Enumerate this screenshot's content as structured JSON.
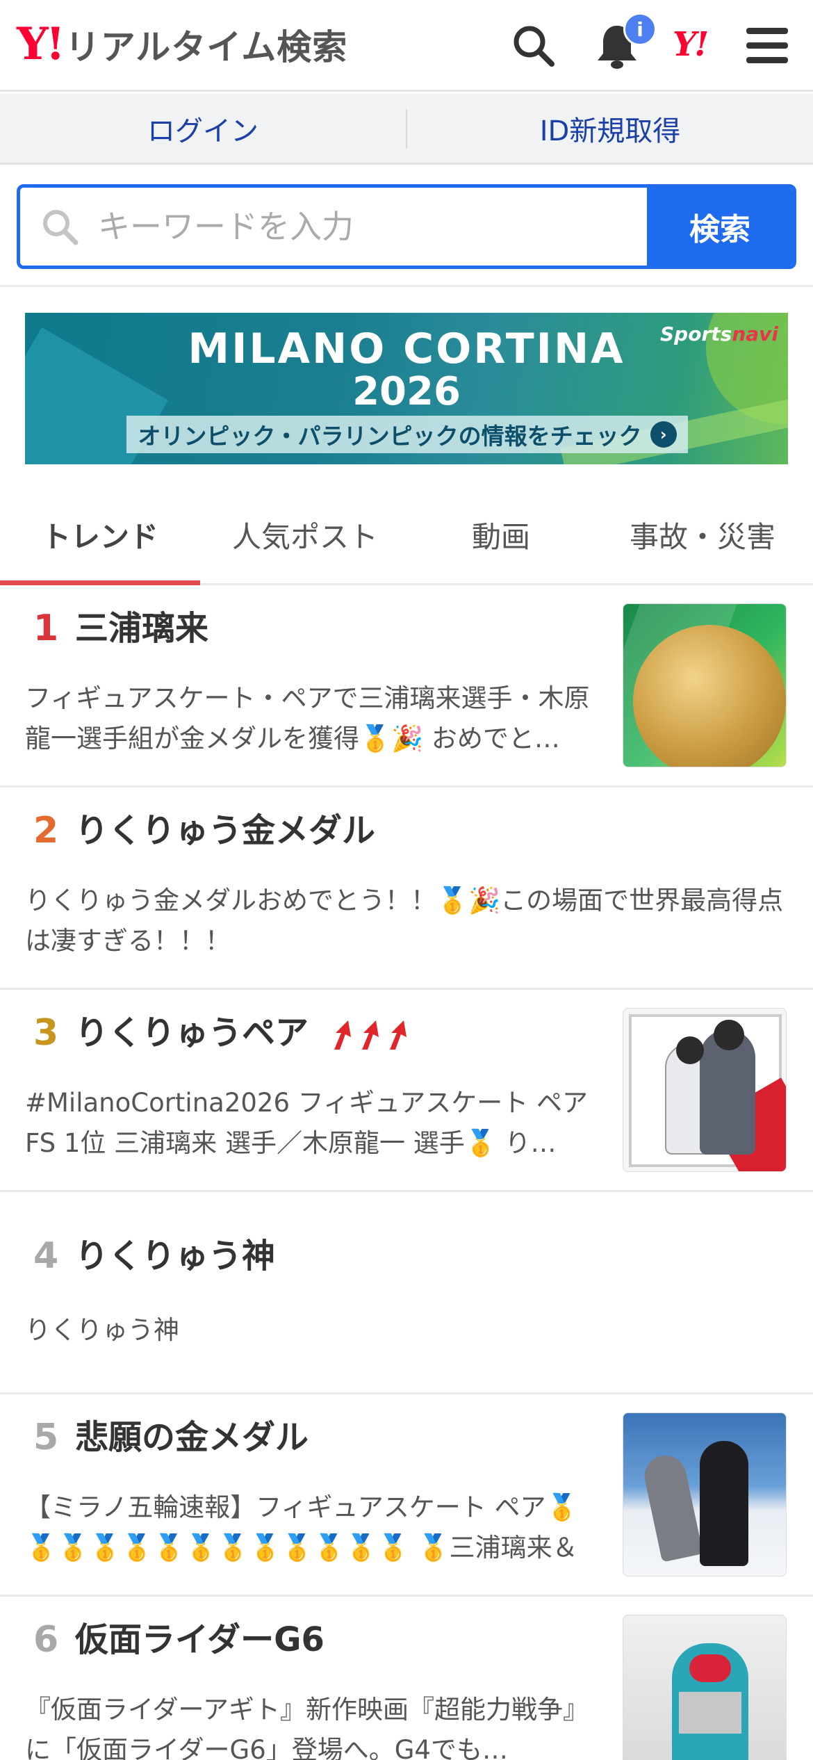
{
  "header": {
    "logo_mark": "Y!",
    "logo_text": "リアルタイム検索",
    "notification_badge": "i",
    "yj_mark": "Y!"
  },
  "account": {
    "login": "ログイン",
    "register": "ID新規取得"
  },
  "search": {
    "placeholder": "キーワードを入力",
    "button": "検索"
  },
  "banner": {
    "title": "MILANO CORTINA",
    "year": "2026",
    "subtitle": "オリンピック・パラリンピックの情報をチェック",
    "arrow": "›",
    "brand_a": "Sports",
    "brand_b": "navi"
  },
  "tabs": [
    {
      "label": "トレンド",
      "active": true
    },
    {
      "label": "人気ポスト",
      "active": false
    },
    {
      "label": "動画",
      "active": false
    },
    {
      "label": "事故・災害",
      "active": false
    }
  ],
  "colors": {
    "accent": "#1f6bf0",
    "tab_active": "#e14b50",
    "rank1": "#d9343a",
    "rank2": "#e56a2f",
    "rank3": "#c8961e",
    "rank_other": "#a8a8a8",
    "rising_arrow": "#e0262b"
  },
  "trends": [
    {
      "rank": "1",
      "title": "三浦璃来",
      "description": "フィギュアスケート・ペアで三浦璃来選手・木原龍一選手組が金メダルを獲得🥇🎉 おめでと…",
      "thumbnail": "gold-medal"
    },
    {
      "rank": "2",
      "title": "りくりゅう金メダル",
      "description": "りくりゅう金メダルおめでとう！！🥇🎉この場面で世界最高得点は凄すぎる！！！",
      "thumbnail": ""
    },
    {
      "rank": "3",
      "title": "りくりゅうペア",
      "rising": true,
      "description": "#MilanoCortina2026 フィギュアスケート ペアFS 1位 三浦璃来 選手／木原龍一 選手🥇 り…",
      "thumbnail": "pair-skaters-with-medals"
    },
    {
      "rank": "4",
      "title": "りくりゅう神",
      "description": "りくりゅう神",
      "thumbnail": ""
    },
    {
      "rank": "5",
      "title": "悲願の金メダル",
      "description": "【ミラノ五輪速報】フィギュアスケート ペア🥇🥇🥇🥇🥇🥇🥇🥇🥇🥇🥇🥇🥇 🥇三浦璃来＆木原龍一ペア…",
      "thumbnail": "pair-skating-performance"
    },
    {
      "rank": "6",
      "title": "仮面ライダーG6",
      "description": "『仮面ライダーアギト』新作映画『超能力戦争』に「仮面ライダーG6」登場へ。G4でも…",
      "thumbnail": "kamen-rider-figure"
    }
  ]
}
